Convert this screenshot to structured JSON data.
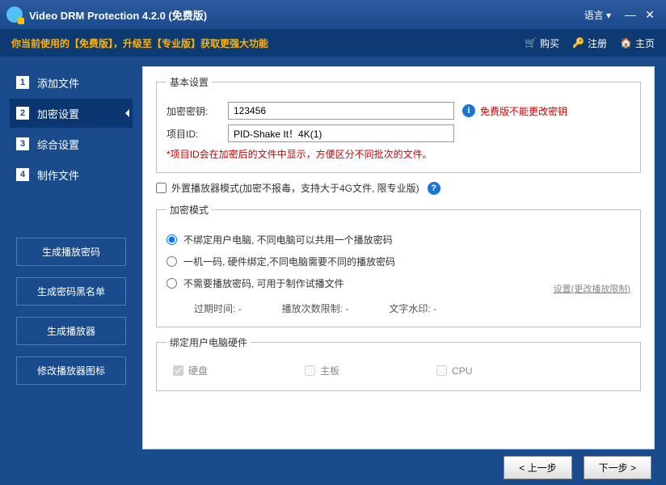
{
  "title": "Video DRM Protection 4.2.0 (免费版)",
  "lang": "语言 ▾",
  "topbar": {
    "notice": "你当前使用的【免费版】，升级至【专业版】获取更强大功能",
    "buy": "购买",
    "register": "注册",
    "home": "主页"
  },
  "steps": [
    {
      "n": "1",
      "label": "添加文件"
    },
    {
      "n": "2",
      "label": "加密设置"
    },
    {
      "n": "3",
      "label": "综合设置"
    },
    {
      "n": "4",
      "label": "制作文件"
    }
  ],
  "sideButtons": [
    "生成播放密码",
    "生成密码黑名单",
    "生成播放器",
    "修改播放器图标"
  ],
  "basic": {
    "legend": "基本设置",
    "keyLabel": "加密密钥:",
    "keyValue": "123456",
    "keyWarn": "免费版不能更改密钥",
    "pidLabel": "项目ID:",
    "pidValue": "PID-Shake It！4K(1)",
    "hint": "*项目ID会在加密后的文件中显示，方便区分不同批次的文件。"
  },
  "external": "外置播放器模式(加密不报毒，支持大于4G文件, 限专业版)",
  "mode": {
    "legend": "加密模式",
    "r1": "不绑定用户电脑, 不同电脑可以共用一个播放密码",
    "r2": "一机一码, 硬件绑定,不同电脑需要不同的播放密码",
    "r3": "不需要播放密码, 可用于制作试播文件",
    "settings": "设置(更改播放限制)",
    "expire": "过期时间: -",
    "plays": "播放次数限制: -",
    "watermark": "文字水印: -"
  },
  "hw": {
    "legend": "绑定用户电脑硬件",
    "hdd": "硬盘",
    "mb": "主板",
    "cpu": "CPU"
  },
  "nav": {
    "prev": "< 上一步",
    "next": "下一步 >"
  }
}
